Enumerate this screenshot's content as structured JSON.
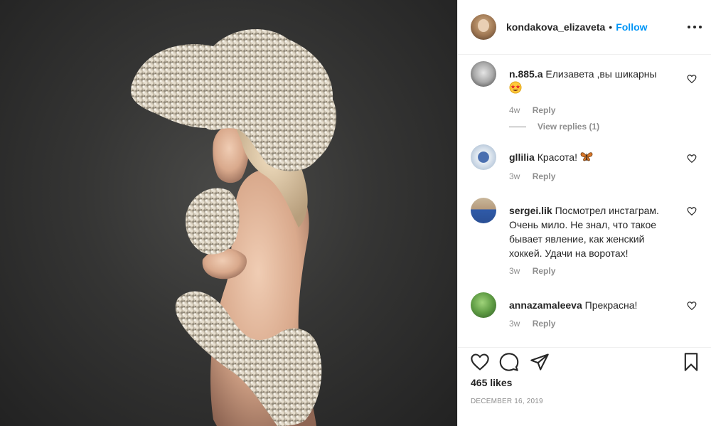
{
  "post": {
    "author": {
      "username": "kondakova_elizaveta",
      "separator": "•",
      "follow_label": "Follow"
    },
    "photo": {
      "subject": "woman-with-babys-breath-flower-headpiece",
      "background_color": "#333333"
    },
    "comments": [
      {
        "username": "n.885.a",
        "text": "Елизавета ,вы шикарны",
        "emoji": "star-struck",
        "time": "4w",
        "reply_label": "Reply",
        "view_replies": "View replies (1)"
      },
      {
        "username": "gllilia",
        "text": "Красота!",
        "emoji": "butterfly",
        "time": "3w",
        "reply_label": "Reply"
      },
      {
        "username": "sergei.lik",
        "text": "Посмотрел инстаграм. Очень мило. Не знал, что такое бывает явление, как женский хоккей. Удачи на воротах!",
        "time": "3w",
        "reply_label": "Reply"
      },
      {
        "username": "annazamaleeva",
        "text": "Прекрасна!",
        "time": "3w",
        "reply_label": "Reply"
      }
    ],
    "actions": {
      "likes": "465 likes",
      "date": "DECEMBER 16, 2019"
    },
    "colors": {
      "accent": "#0095f6",
      "text": "#262626",
      "muted": "#8e8e8e",
      "border": "#efefef"
    }
  }
}
